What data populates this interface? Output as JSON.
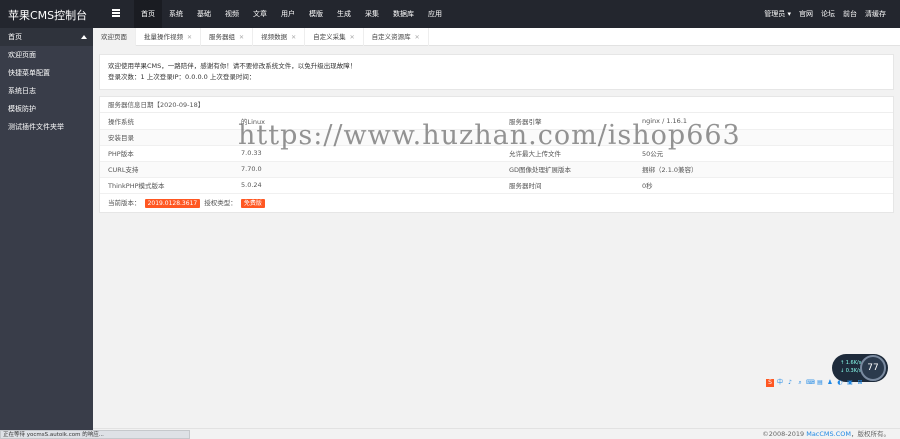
{
  "app": {
    "title": "苹果CMS控制台"
  },
  "topnav": [
    "首页",
    "系统",
    "基础",
    "视频",
    "文章",
    "用户",
    "模版",
    "生成",
    "采集",
    "数据库",
    "应用"
  ],
  "topright": [
    "管理员 ▾",
    "官网",
    "论坛",
    "前台",
    "清缓存"
  ],
  "sidebar": {
    "head": "首页",
    "items": [
      "欢迎页面",
      "快捷菜单配置",
      "系统日志",
      "模板防护",
      "测试插件文件夹举"
    ]
  },
  "tabs": [
    {
      "label": "欢迎页面",
      "active": true,
      "closable": false
    },
    {
      "label": "批量操作视频",
      "closable": true
    },
    {
      "label": "服务器组",
      "closable": true
    },
    {
      "label": "视频数据",
      "closable": true
    },
    {
      "label": "自定义采集",
      "closable": true
    },
    {
      "label": "自定义资源库",
      "closable": true
    }
  ],
  "welcome": {
    "line1": "欢迎使用苹果CMS，一路陪伴，感谢有你！请不要修改系统文件，以免升级出现故障！",
    "line2": "登录次数：1 上次登录IP：0.0.0.0 上次登录时间："
  },
  "server_info": {
    "title": "服务器信息日期【2020-09-18】",
    "rows": [
      [
        "操作系统",
        "的Linux",
        "服务器引擎",
        "nginx / 1.16.1"
      ],
      [
        "安装目录",
        "",
        "",
        ""
      ],
      [
        "PHP版本",
        "7.0.33",
        "允许最大上传文件",
        "50公元"
      ],
      [
        "CURL支持",
        "7.70.0",
        "GD图像处理扩展版本",
        "捆绑（2.1.0兼容）"
      ],
      [
        "ThinkPHP模式版本",
        "5.0.24",
        "服务器时间",
        "0秒"
      ]
    ],
    "version_label": "当前版本：",
    "version_value": "2019.0128.3617",
    "update_label": "授权类型：",
    "update_value": "免费版"
  },
  "gauge": {
    "line1": "↑ 1.6K/s",
    "line2": "↓ 0.3K/s",
    "value": "77"
  },
  "iconstrip": [
    "S",
    "中",
    "♪",
    "⌕",
    "⌨",
    "▤",
    "♟",
    "◐",
    "▣",
    "⊞"
  ],
  "footer": {
    "copy_prefix": "©2008-2019 ",
    "copy_link": "MacCMS.COM",
    "copy_suffix": "，版权所有。"
  },
  "statusbar": "正在等待 yocmsS.autoik.com 的响应...",
  "watermark": "https://www.huzhan.com/ishop663",
  "colors": {
    "topbar": "#23262e",
    "sidebar": "#393d49",
    "badge": "#ff5722",
    "link": "#1e88e5"
  }
}
